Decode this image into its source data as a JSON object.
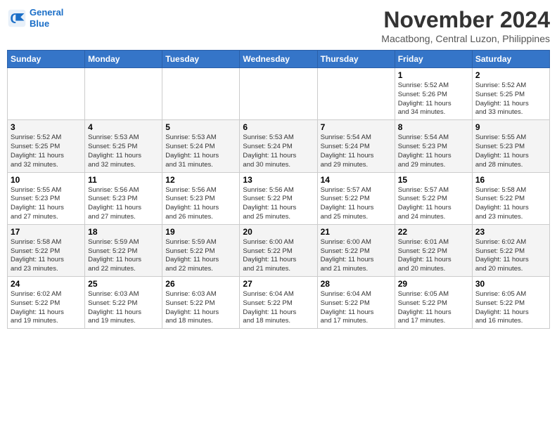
{
  "header": {
    "logo_line1": "General",
    "logo_line2": "Blue",
    "month": "November 2024",
    "location": "Macatbong, Central Luzon, Philippines"
  },
  "weekdays": [
    "Sunday",
    "Monday",
    "Tuesday",
    "Wednesday",
    "Thursday",
    "Friday",
    "Saturday"
  ],
  "weeks": [
    [
      {
        "day": "",
        "info": ""
      },
      {
        "day": "",
        "info": ""
      },
      {
        "day": "",
        "info": ""
      },
      {
        "day": "",
        "info": ""
      },
      {
        "day": "",
        "info": ""
      },
      {
        "day": "1",
        "info": "Sunrise: 5:52 AM\nSunset: 5:26 PM\nDaylight: 11 hours\nand 34 minutes."
      },
      {
        "day": "2",
        "info": "Sunrise: 5:52 AM\nSunset: 5:25 PM\nDaylight: 11 hours\nand 33 minutes."
      }
    ],
    [
      {
        "day": "3",
        "info": "Sunrise: 5:52 AM\nSunset: 5:25 PM\nDaylight: 11 hours\nand 32 minutes."
      },
      {
        "day": "4",
        "info": "Sunrise: 5:53 AM\nSunset: 5:25 PM\nDaylight: 11 hours\nand 32 minutes."
      },
      {
        "day": "5",
        "info": "Sunrise: 5:53 AM\nSunset: 5:24 PM\nDaylight: 11 hours\nand 31 minutes."
      },
      {
        "day": "6",
        "info": "Sunrise: 5:53 AM\nSunset: 5:24 PM\nDaylight: 11 hours\nand 30 minutes."
      },
      {
        "day": "7",
        "info": "Sunrise: 5:54 AM\nSunset: 5:24 PM\nDaylight: 11 hours\nand 29 minutes."
      },
      {
        "day": "8",
        "info": "Sunrise: 5:54 AM\nSunset: 5:23 PM\nDaylight: 11 hours\nand 29 minutes."
      },
      {
        "day": "9",
        "info": "Sunrise: 5:55 AM\nSunset: 5:23 PM\nDaylight: 11 hours\nand 28 minutes."
      }
    ],
    [
      {
        "day": "10",
        "info": "Sunrise: 5:55 AM\nSunset: 5:23 PM\nDaylight: 11 hours\nand 27 minutes."
      },
      {
        "day": "11",
        "info": "Sunrise: 5:56 AM\nSunset: 5:23 PM\nDaylight: 11 hours\nand 27 minutes."
      },
      {
        "day": "12",
        "info": "Sunrise: 5:56 AM\nSunset: 5:23 PM\nDaylight: 11 hours\nand 26 minutes."
      },
      {
        "day": "13",
        "info": "Sunrise: 5:56 AM\nSunset: 5:22 PM\nDaylight: 11 hours\nand 25 minutes."
      },
      {
        "day": "14",
        "info": "Sunrise: 5:57 AM\nSunset: 5:22 PM\nDaylight: 11 hours\nand 25 minutes."
      },
      {
        "day": "15",
        "info": "Sunrise: 5:57 AM\nSunset: 5:22 PM\nDaylight: 11 hours\nand 24 minutes."
      },
      {
        "day": "16",
        "info": "Sunrise: 5:58 AM\nSunset: 5:22 PM\nDaylight: 11 hours\nand 23 minutes."
      }
    ],
    [
      {
        "day": "17",
        "info": "Sunrise: 5:58 AM\nSunset: 5:22 PM\nDaylight: 11 hours\nand 23 minutes."
      },
      {
        "day": "18",
        "info": "Sunrise: 5:59 AM\nSunset: 5:22 PM\nDaylight: 11 hours\nand 22 minutes."
      },
      {
        "day": "19",
        "info": "Sunrise: 5:59 AM\nSunset: 5:22 PM\nDaylight: 11 hours\nand 22 minutes."
      },
      {
        "day": "20",
        "info": "Sunrise: 6:00 AM\nSunset: 5:22 PM\nDaylight: 11 hours\nand 21 minutes."
      },
      {
        "day": "21",
        "info": "Sunrise: 6:00 AM\nSunset: 5:22 PM\nDaylight: 11 hours\nand 21 minutes."
      },
      {
        "day": "22",
        "info": "Sunrise: 6:01 AM\nSunset: 5:22 PM\nDaylight: 11 hours\nand 20 minutes."
      },
      {
        "day": "23",
        "info": "Sunrise: 6:02 AM\nSunset: 5:22 PM\nDaylight: 11 hours\nand 20 minutes."
      }
    ],
    [
      {
        "day": "24",
        "info": "Sunrise: 6:02 AM\nSunset: 5:22 PM\nDaylight: 11 hours\nand 19 minutes."
      },
      {
        "day": "25",
        "info": "Sunrise: 6:03 AM\nSunset: 5:22 PM\nDaylight: 11 hours\nand 19 minutes."
      },
      {
        "day": "26",
        "info": "Sunrise: 6:03 AM\nSunset: 5:22 PM\nDaylight: 11 hours\nand 18 minutes."
      },
      {
        "day": "27",
        "info": "Sunrise: 6:04 AM\nSunset: 5:22 PM\nDaylight: 11 hours\nand 18 minutes."
      },
      {
        "day": "28",
        "info": "Sunrise: 6:04 AM\nSunset: 5:22 PM\nDaylight: 11 hours\nand 17 minutes."
      },
      {
        "day": "29",
        "info": "Sunrise: 6:05 AM\nSunset: 5:22 PM\nDaylight: 11 hours\nand 17 minutes."
      },
      {
        "day": "30",
        "info": "Sunrise: 6:05 AM\nSunset: 5:22 PM\nDaylight: 11 hours\nand 16 minutes."
      }
    ]
  ]
}
